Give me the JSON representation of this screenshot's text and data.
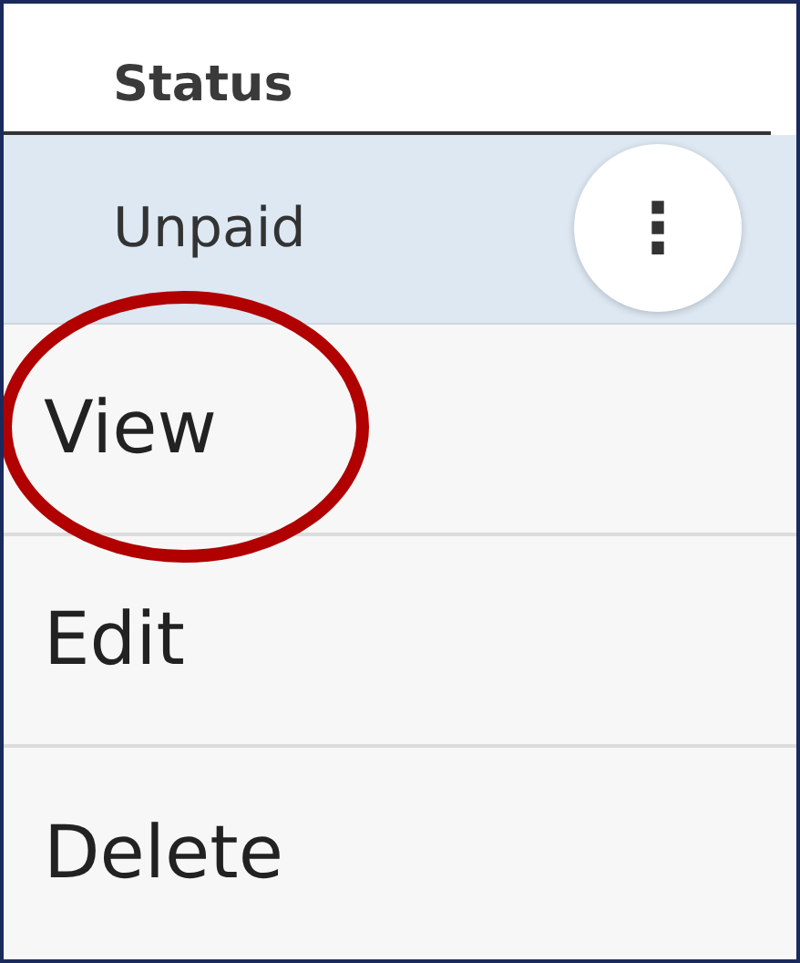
{
  "table": {
    "columns": [
      {
        "label": "Status"
      }
    ],
    "rows": [
      {
        "status": "Unpaid",
        "selected": true,
        "menu_button": {
          "glyph": "⋮"
        }
      }
    ]
  },
  "menu": {
    "items": [
      {
        "label": "View",
        "circled": true
      },
      {
        "label": "Edit",
        "circled": false
      },
      {
        "label": "Delete",
        "circled": false
      }
    ]
  }
}
